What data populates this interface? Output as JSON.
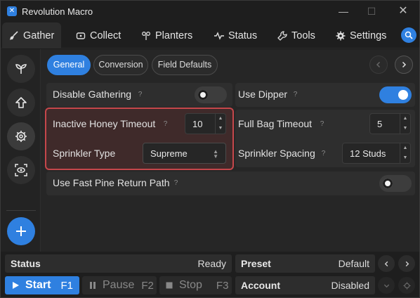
{
  "window": {
    "title": "Revolution Macro",
    "icon": "revolution-macro-icon"
  },
  "tabs": [
    {
      "label": "Gather",
      "icon": "broom-icon",
      "active": true
    },
    {
      "label": "Collect",
      "icon": "collect-icon",
      "active": false
    },
    {
      "label": "Planters",
      "icon": "planter-icon",
      "active": false
    },
    {
      "label": "Status",
      "icon": "pulse-icon",
      "active": false
    },
    {
      "label": "Tools",
      "icon": "wrench-icon",
      "active": false
    },
    {
      "label": "Settings",
      "icon": "gear-icon",
      "active": false
    }
  ],
  "rail": [
    {
      "icon": "sprout-icon",
      "active": false
    },
    {
      "icon": "arrow-up-icon",
      "active": false
    },
    {
      "icon": "gear-icon",
      "active": true
    },
    {
      "icon": "target-icon",
      "active": false
    }
  ],
  "subtabs": [
    {
      "label": "General",
      "active": true
    },
    {
      "label": "Conversion",
      "active": false
    },
    {
      "label": "Field Defaults",
      "active": false
    }
  ],
  "settings": {
    "disable_gathering": {
      "label": "Disable Gathering",
      "help": "?",
      "on": false
    },
    "use_dipper": {
      "label": "Use Dipper",
      "help": "?",
      "on": true
    },
    "inactive_honey_timeout": {
      "label": "Inactive Honey Timeout",
      "help": "?",
      "value": "10"
    },
    "full_bag_timeout": {
      "label": "Full Bag Timeout",
      "help": "?",
      "value": "5"
    },
    "sprinkler_type": {
      "label": "Sprinkler Type",
      "value": "Supreme"
    },
    "sprinkler_spacing": {
      "label": "Sprinkler Spacing",
      "help": "?",
      "value": "12 Studs"
    },
    "use_fast_pine": {
      "label": "Use Fast Pine Return Path",
      "help": "?",
      "on": false
    }
  },
  "bottom": {
    "status_label": "Status",
    "status_value": "Ready",
    "preset_label": "Preset",
    "preset_value": "Default",
    "account_label": "Account",
    "account_value": "Disabled",
    "start_label": "Start",
    "start_key": "F1",
    "pause_label": "Pause",
    "pause_key": "F2",
    "stop_label": "Stop",
    "stop_key": "F3"
  },
  "colors": {
    "accent": "#2f80e0",
    "highlight_border": "#c5474b"
  }
}
